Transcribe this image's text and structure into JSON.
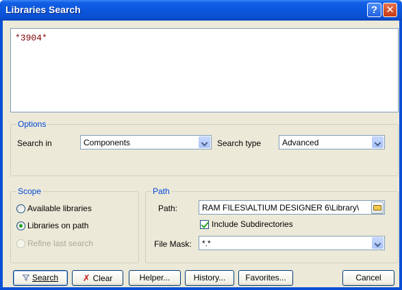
{
  "window": {
    "title": "Libraries Search",
    "help_glyph": "?",
    "close_glyph": "✕"
  },
  "query": {
    "text": "*3904*"
  },
  "options": {
    "group_label": "Options",
    "search_in_label": "Search in",
    "search_in_value": "Components",
    "search_type_label": "Search type",
    "search_type_value": "Advanced"
  },
  "scope": {
    "group_label": "Scope",
    "radios": [
      {
        "label": "Available libraries",
        "checked": false,
        "enabled": true
      },
      {
        "label": "Libraries on path",
        "checked": true,
        "enabled": true
      },
      {
        "label": "Refine last search",
        "checked": false,
        "enabled": false
      }
    ]
  },
  "path": {
    "group_label": "Path",
    "path_label": "Path:",
    "path_value": "RAM FILES\\ALTIUM DESIGNER 6\\Library\\",
    "include_subdirs_label": "Include Subdirectories",
    "include_subdirs_checked": true,
    "file_mask_label": "File Mask:",
    "file_mask_value": "*.*"
  },
  "buttons": {
    "search": "Search",
    "clear": "Clear",
    "helper": "Helper...",
    "history": "History...",
    "favorites": "Favorites...",
    "cancel": "Cancel"
  },
  "icons": {
    "search_button_icon": "funnel-icon",
    "clear_button_icon": "eraser-x-icon",
    "browse_icon": "folder-icon",
    "dropdown_icon": "chevron-down-icon"
  }
}
